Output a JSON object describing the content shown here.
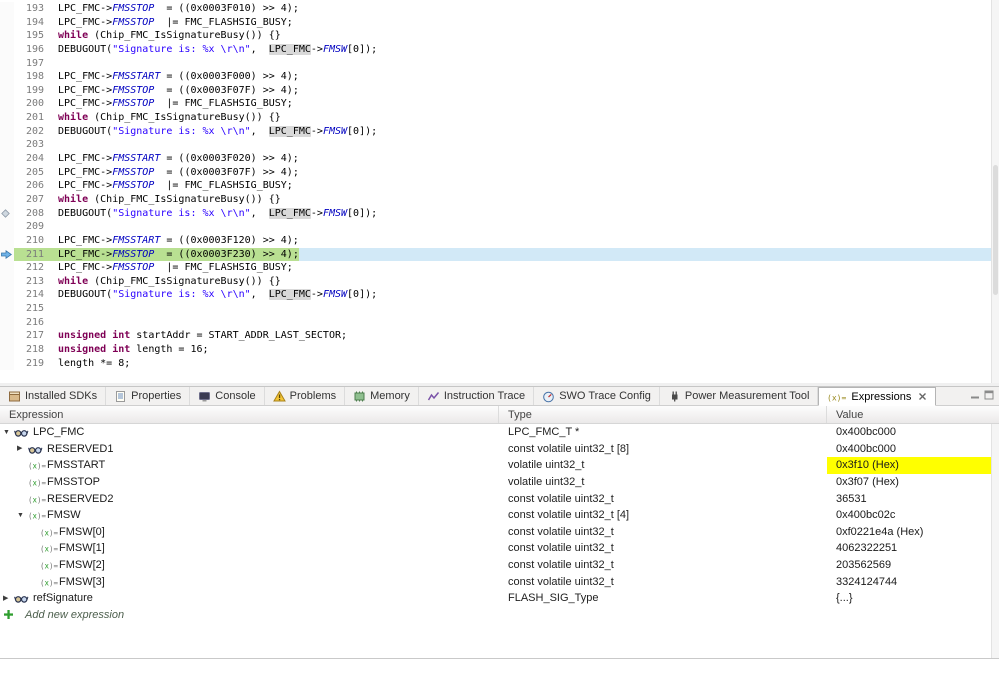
{
  "colors": {
    "changed_value_highlight": "#ffff00",
    "debug_current_line_green": "#b9e092",
    "current_line_selection_blue": "#d2e9f7",
    "keyword": "#7f0055",
    "string_literal": "#2a00ff",
    "struct_field": "#0000c0",
    "occurrence_highlight": "#d9d9d9"
  },
  "editor": {
    "current_line": 211,
    "markers": [
      {
        "line": 208,
        "icon": "bookmark-diamond-icon"
      },
      {
        "line": 211,
        "icon": "instruction-pointer-icon"
      }
    ],
    "lines": [
      {
        "n": 193,
        "segs": [
          [
            "p",
            "LPC_FMC->"
          ],
          [
            "f",
            "FMSSTOP"
          ],
          [
            "p",
            "  = ((0x0003F010) >> 4);"
          ]
        ]
      },
      {
        "n": 194,
        "segs": [
          [
            "p",
            "LPC_FMC->"
          ],
          [
            "f",
            "FMSSTOP"
          ],
          [
            "p",
            "  |= FMC_FLASHSIG_BUSY;"
          ]
        ]
      },
      {
        "n": 195,
        "segs": [
          [
            "k",
            "while"
          ],
          [
            "p",
            " (Chip_FMC_IsSignatureBusy()) {}"
          ]
        ]
      },
      {
        "n": 196,
        "segs": [
          [
            "p",
            "DEBUGOUT("
          ],
          [
            "s",
            "\"Signature is: %x \\r\\n\""
          ],
          [
            "p",
            ",  "
          ],
          [
            "o",
            "LPC_FMC"
          ],
          [
            "p",
            "->"
          ],
          [
            "f",
            "FMSW"
          ],
          [
            "p",
            "[0]);"
          ]
        ]
      },
      {
        "n": 197,
        "segs": []
      },
      {
        "n": 198,
        "segs": [
          [
            "p",
            "LPC_FMC->"
          ],
          [
            "f",
            "FMSSTART"
          ],
          [
            "p",
            " = ((0x0003F000) >> 4);"
          ]
        ]
      },
      {
        "n": 199,
        "segs": [
          [
            "p",
            "LPC_FMC->"
          ],
          [
            "f",
            "FMSSTOP"
          ],
          [
            "p",
            "  = ((0x0003F07F) >> 4);"
          ]
        ]
      },
      {
        "n": 200,
        "segs": [
          [
            "p",
            "LPC_FMC->"
          ],
          [
            "f",
            "FMSSTOP"
          ],
          [
            "p",
            "  |= FMC_FLASHSIG_BUSY;"
          ]
        ]
      },
      {
        "n": 201,
        "segs": [
          [
            "k",
            "while"
          ],
          [
            "p",
            " (Chip_FMC_IsSignatureBusy()) {}"
          ]
        ]
      },
      {
        "n": 202,
        "segs": [
          [
            "p",
            "DEBUGOUT("
          ],
          [
            "s",
            "\"Signature is: %x \\r\\n\""
          ],
          [
            "p",
            ",  "
          ],
          [
            "o",
            "LPC_FMC"
          ],
          [
            "p",
            "->"
          ],
          [
            "f",
            "FMSW"
          ],
          [
            "p",
            "[0]);"
          ]
        ]
      },
      {
        "n": 203,
        "segs": []
      },
      {
        "n": 204,
        "segs": [
          [
            "p",
            "LPC_FMC->"
          ],
          [
            "f",
            "FMSSTART"
          ],
          [
            "p",
            " = ((0x0003F020) >> 4);"
          ]
        ]
      },
      {
        "n": 205,
        "segs": [
          [
            "p",
            "LPC_FMC->"
          ],
          [
            "f",
            "FMSSTOP"
          ],
          [
            "p",
            "  = ((0x0003F07F) >> 4);"
          ]
        ]
      },
      {
        "n": 206,
        "segs": [
          [
            "p",
            "LPC_FMC->"
          ],
          [
            "f",
            "FMSSTOP"
          ],
          [
            "p",
            "  |= FMC_FLASHSIG_BUSY;"
          ]
        ]
      },
      {
        "n": 207,
        "segs": [
          [
            "k",
            "while"
          ],
          [
            "p",
            " (Chip_FMC_IsSignatureBusy()) {}"
          ]
        ]
      },
      {
        "n": 208,
        "segs": [
          [
            "p",
            "DEBUGOUT("
          ],
          [
            "s",
            "\"Signature is: %x \\r\\n\""
          ],
          [
            "p",
            ",  "
          ],
          [
            "o",
            "LPC_FMC"
          ],
          [
            "p",
            "->"
          ],
          [
            "f",
            "FMSW"
          ],
          [
            "p",
            "[0]);"
          ]
        ]
      },
      {
        "n": 209,
        "segs": []
      },
      {
        "n": 210,
        "segs": [
          [
            "p",
            "LPC_FMC->"
          ],
          [
            "f",
            "FMSSTART"
          ],
          [
            "p",
            " = ((0x0003F120) >> 4);"
          ]
        ]
      },
      {
        "n": 211,
        "segs": [
          [
            "p",
            "LPC_FMC->"
          ],
          [
            "f",
            "FMSSTOP"
          ],
          [
            "p",
            "  = ((0x0003F230) >> 4);"
          ]
        ]
      },
      {
        "n": 212,
        "segs": [
          [
            "p",
            "LPC_FMC->"
          ],
          [
            "f",
            "FMSSTOP"
          ],
          [
            "p",
            "  |= FMC_FLASHSIG_BUSY;"
          ]
        ]
      },
      {
        "n": 213,
        "segs": [
          [
            "k",
            "while"
          ],
          [
            "p",
            " (Chip_FMC_IsSignatureBusy()) {}"
          ]
        ]
      },
      {
        "n": 214,
        "segs": [
          [
            "p",
            "DEBUGOUT("
          ],
          [
            "s",
            "\"Signature is: %x \\r\\n\""
          ],
          [
            "p",
            ",  "
          ],
          [
            "o",
            "LPC_FMC"
          ],
          [
            "p",
            "->"
          ],
          [
            "f",
            "FMSW"
          ],
          [
            "p",
            "[0]);"
          ]
        ]
      },
      {
        "n": 215,
        "segs": []
      },
      {
        "n": 216,
        "segs": []
      },
      {
        "n": 217,
        "segs": [
          [
            "k",
            "unsigned"
          ],
          [
            "p",
            " "
          ],
          [
            "k",
            "int"
          ],
          [
            "p",
            " startAddr = START_ADDR_LAST_SECTOR;"
          ]
        ]
      },
      {
        "n": 218,
        "segs": [
          [
            "k",
            "unsigned"
          ],
          [
            "p",
            " "
          ],
          [
            "k",
            "int"
          ],
          [
            "p",
            " length = 16;"
          ]
        ]
      },
      {
        "n": 219,
        "segs": [
          [
            "p",
            "length *= 8;"
          ]
        ]
      }
    ]
  },
  "panel": {
    "tabs": [
      {
        "label": "Installed SDKs",
        "icon": "sdk-package-icon"
      },
      {
        "label": "Properties",
        "icon": "properties-icon"
      },
      {
        "label": "Console",
        "icon": "console-icon"
      },
      {
        "label": "Problems",
        "icon": "problems-icon"
      },
      {
        "label": "Memory",
        "icon": "memory-chip-icon"
      },
      {
        "label": "Instruction Trace",
        "icon": "instruction-trace-icon"
      },
      {
        "label": "SWO Trace Config",
        "icon": "swo-gauge-icon"
      },
      {
        "label": "Power Measurement Tool",
        "icon": "power-plug-icon"
      },
      {
        "label": "Expressions",
        "icon": "expressions-icon",
        "active": true,
        "closable": true
      }
    ],
    "window_controls": [
      {
        "icon": "minimize-icon"
      },
      {
        "icon": "maximize-icon"
      }
    ],
    "columns": [
      "Expression",
      "Type",
      "Value"
    ],
    "rows": [
      {
        "level": 0,
        "expander": "expanded",
        "icon": "watch-expression-icon",
        "label": "LPC_FMC",
        "type": "LPC_FMC_T *",
        "value": "0x400bc000"
      },
      {
        "level": 1,
        "expander": "collapsed",
        "icon": "watch-expression-icon",
        "label": "RESERVED1",
        "type": "const volatile uint32_t [8]",
        "value": "0x400bc000"
      },
      {
        "level": 1,
        "expander": "",
        "icon": "variable-icon",
        "label": "FMSSTART",
        "type": "volatile uint32_t",
        "value": "0x3f10 (Hex)",
        "changed": true
      },
      {
        "level": 1,
        "expander": "",
        "icon": "variable-icon",
        "label": "FMSSTOP",
        "type": "volatile uint32_t",
        "value": "0x3f07 (Hex)"
      },
      {
        "level": 1,
        "expander": "",
        "icon": "variable-icon",
        "label": "RESERVED2",
        "type": "const volatile uint32_t",
        "value": "36531"
      },
      {
        "level": 1,
        "expander": "expanded",
        "icon": "variable-icon",
        "label": "FMSW",
        "type": "const volatile uint32_t [4]",
        "value": "0x400bc02c"
      },
      {
        "level": 2,
        "expander": "",
        "icon": "variable-icon",
        "label": "FMSW[0]",
        "type": "const volatile uint32_t",
        "value": "0xf0221e4a (Hex)"
      },
      {
        "level": 2,
        "expander": "",
        "icon": "variable-icon",
        "label": "FMSW[1]",
        "type": "const volatile uint32_t",
        "value": "4062322251"
      },
      {
        "level": 2,
        "expander": "",
        "icon": "variable-icon",
        "label": "FMSW[2]",
        "type": "const volatile uint32_t",
        "value": "203562569"
      },
      {
        "level": 2,
        "expander": "",
        "icon": "variable-icon",
        "label": "FMSW[3]",
        "type": "const volatile uint32_t",
        "value": "3324124744"
      },
      {
        "level": 0,
        "expander": "collapsed",
        "icon": "watch-expression-icon",
        "label": "refSignature",
        "type": "FLASH_SIG_Type",
        "value": "{...}"
      }
    ],
    "add_row": {
      "icon": "add-expression-icon",
      "label": "Add new expression"
    }
  }
}
